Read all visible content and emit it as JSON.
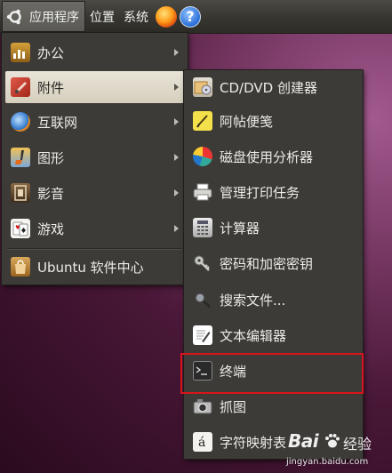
{
  "panel": {
    "menus": [
      "应用程序",
      "位置",
      "系统"
    ],
    "icons": [
      "ubuntu-logo-icon",
      "firefox-icon",
      "help-icon"
    ],
    "help_glyph": "?"
  },
  "main_menu": {
    "items": [
      {
        "label": "办公",
        "icon": "office-icon",
        "submenu": true
      },
      {
        "label": "附件",
        "icon": "accessories-icon",
        "submenu": true,
        "active": true
      },
      {
        "label": "互联网",
        "icon": "internet-icon",
        "submenu": true
      },
      {
        "label": "图形",
        "icon": "graphics-icon",
        "submenu": true
      },
      {
        "label": "影音",
        "icon": "multimedia-icon",
        "submenu": true
      },
      {
        "label": "游戏",
        "icon": "games-icon",
        "submenu": true
      },
      {
        "label": "Ubuntu 软件中心",
        "icon": "software-center-icon",
        "submenu": false
      }
    ]
  },
  "sub_menu": {
    "items": [
      {
        "label": "CD/DVD 创建器",
        "icon": "cd-dvd-creator-icon"
      },
      {
        "label": "阿帖便笺",
        "icon": "sticky-notes-icon"
      },
      {
        "label": "磁盘使用分析器",
        "icon": "disk-usage-icon"
      },
      {
        "label": "管理打印任务",
        "icon": "printer-icon"
      },
      {
        "label": "计算器",
        "icon": "calculator-icon"
      },
      {
        "label": "密码和加密密钥",
        "icon": "keys-icon"
      },
      {
        "label": "搜索文件...",
        "icon": "search-icon"
      },
      {
        "label": "文本编辑器",
        "icon": "text-editor-icon"
      },
      {
        "label": "终端",
        "icon": "terminal-icon",
        "highlighted": true
      },
      {
        "label": "抓图",
        "icon": "screenshot-icon"
      },
      {
        "label": "字符映射表",
        "icon": "character-map-icon"
      }
    ]
  },
  "watermark": {
    "brand": "Bai",
    "suffix": "经验",
    "url": "jingyan.baidu.com"
  },
  "colors": {
    "panel_bg": "#3a3934",
    "menu_bg": "#3d3b37",
    "active_item": "#ddd6c6",
    "highlight_box": "#d9141b"
  }
}
